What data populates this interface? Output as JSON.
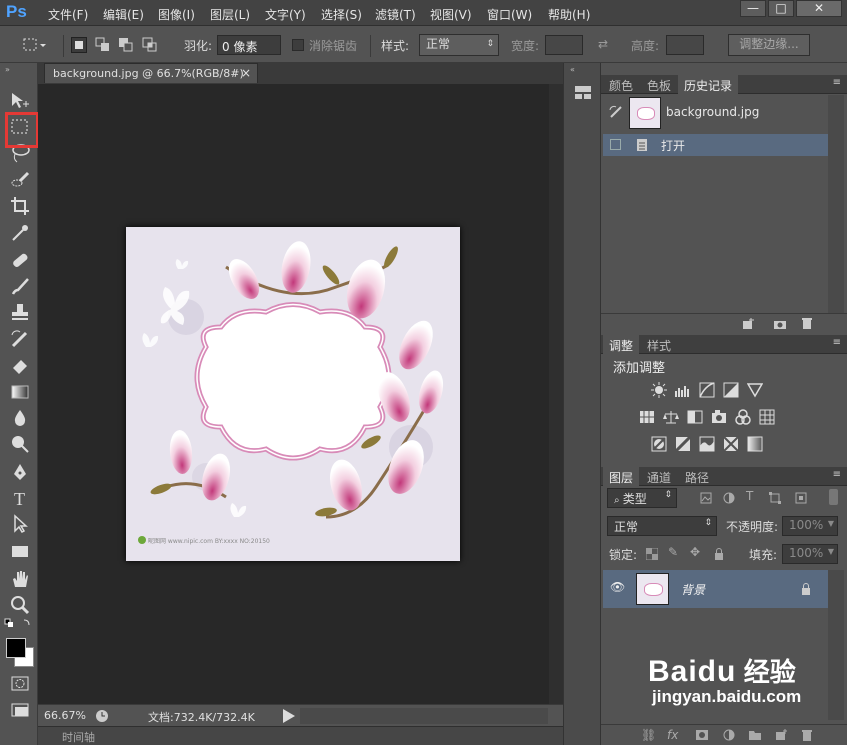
{
  "app": {
    "logo": "Ps"
  },
  "menubar": {
    "items": [
      "文件(F)",
      "编辑(E)",
      "图像(I)",
      "图层(L)",
      "文字(Y)",
      "选择(S)",
      "滤镜(T)",
      "视图(V)",
      "窗口(W)",
      "帮助(H)"
    ],
    "window_buttons": [
      "—",
      "□",
      "✕"
    ]
  },
  "options": {
    "feather_label": "羽化:",
    "feather_value": "0 像素",
    "antialias_label": "消除锯齿",
    "style_label": "样式:",
    "style_value": "正常",
    "width_label": "宽度:",
    "height_label": "高度:",
    "refine_button": "调整边缘..."
  },
  "document": {
    "tab_title": "background.jpg @ 66.7%(RGB/8#)",
    "tab_close": "×",
    "zoom": "66.67%",
    "doc_size": "文档:732.4K/732.4K",
    "image_caption": "昵图网 www.nipic.com  BY:xxxx  NO:20150"
  },
  "timeline": {
    "label": "时间轴"
  },
  "history_panel": {
    "tabs": [
      "颜色",
      "色板",
      "历史记录"
    ],
    "snapshot": "background.jpg",
    "steps": [
      "打开"
    ]
  },
  "adjustments_panel": {
    "tabs": [
      "调整",
      "样式"
    ],
    "title": "添加调整"
  },
  "layers_panel": {
    "tabs": [
      "图层",
      "通道",
      "路径"
    ],
    "kind_label": "类型",
    "blend_mode": "正常",
    "opacity_label": "不透明度:",
    "opacity_value": "100%",
    "lock_label": "锁定:",
    "fill_label": "填充:",
    "fill_value": "100%",
    "layers": [
      "背景"
    ]
  },
  "watermark": {
    "brand": "Baidu",
    "sub": "经验",
    "url": "jingyan.baidu.com"
  },
  "colors": {
    "accent_blue": "#4fa3ff",
    "highlight_red": "#e53935",
    "selected_row": "#596a80"
  }
}
